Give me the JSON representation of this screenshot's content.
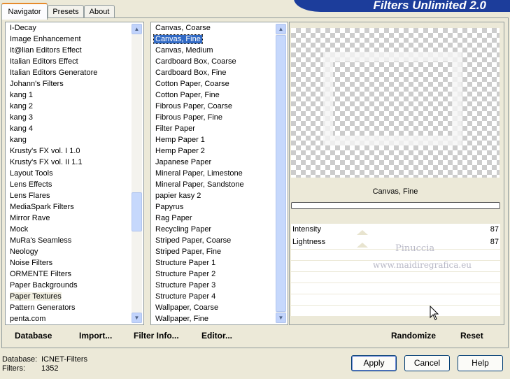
{
  "tabs": [
    "Navigator",
    "Presets",
    "About"
  ],
  "banner_title": "Filters Unlimited 2.0",
  "categories": [
    "I-Decay",
    "Image Enhancement",
    "It@lian Editors Effect",
    "Italian Editors Effect",
    "Italian Editors Generatore",
    "Johann's Filters",
    "kang 1",
    "kang 2",
    "kang 3",
    "kang 4",
    "kang",
    "Krusty's FX vol. I 1.0",
    "Krusty's FX vol. II 1.1",
    "Layout Tools",
    "Lens Effects",
    "Lens Flares",
    "MediaSpark Filters",
    "Mirror Rave",
    "Mock",
    "MuRa's Seamless",
    "Neology",
    "Noise Filters",
    "ORMENTE Filters",
    "Paper Backgrounds",
    "Paper Textures",
    "Pattern Generators",
    "penta.com"
  ],
  "selected_category": "Paper Textures",
  "filters": [
    "Canvas, Coarse",
    "Canvas, Fine",
    "Canvas, Medium",
    "Cardboard Box, Coarse",
    "Cardboard Box, Fine",
    "Cotton Paper, Coarse",
    "Cotton Paper, Fine",
    "Fibrous Paper, Coarse",
    "Fibrous Paper, Fine",
    "Filter Paper",
    "Hemp Paper 1",
    "Hemp Paper 2",
    "Japanese Paper",
    "Mineral Paper, Limestone",
    "Mineral Paper, Sandstone",
    "papier kasy 2",
    "Papyrus",
    "Rag Paper",
    "Recycling Paper",
    "Striped Paper, Coarse",
    "Striped Paper, Fine",
    "Structure Paper 1",
    "Structure Paper 2",
    "Structure Paper 3",
    "Structure Paper 4",
    "Wallpaper, Coarse",
    "Wallpaper, Fine"
  ],
  "selected_filter": "Canvas, Fine",
  "preview_filter_name": "Canvas, Fine",
  "params": [
    {
      "label": "Intensity",
      "value": "87"
    },
    {
      "label": "Lightness",
      "value": "87"
    }
  ],
  "watermark": {
    "line1": "Pinuccia",
    "line2": "www.maidiregrafica.eu"
  },
  "bottom_buttons": {
    "database": "Database",
    "import": "Import...",
    "filter_info": "Filter Info...",
    "editor": "Editor...",
    "randomize": "Randomize",
    "reset": "Reset"
  },
  "status": {
    "database_label": "Database:",
    "database_value": "ICNET-Filters",
    "filters_label": "Filters:",
    "filters_value": "1352"
  },
  "dialog_buttons": {
    "apply": "Apply",
    "cancel": "Cancel",
    "help": "Help"
  }
}
